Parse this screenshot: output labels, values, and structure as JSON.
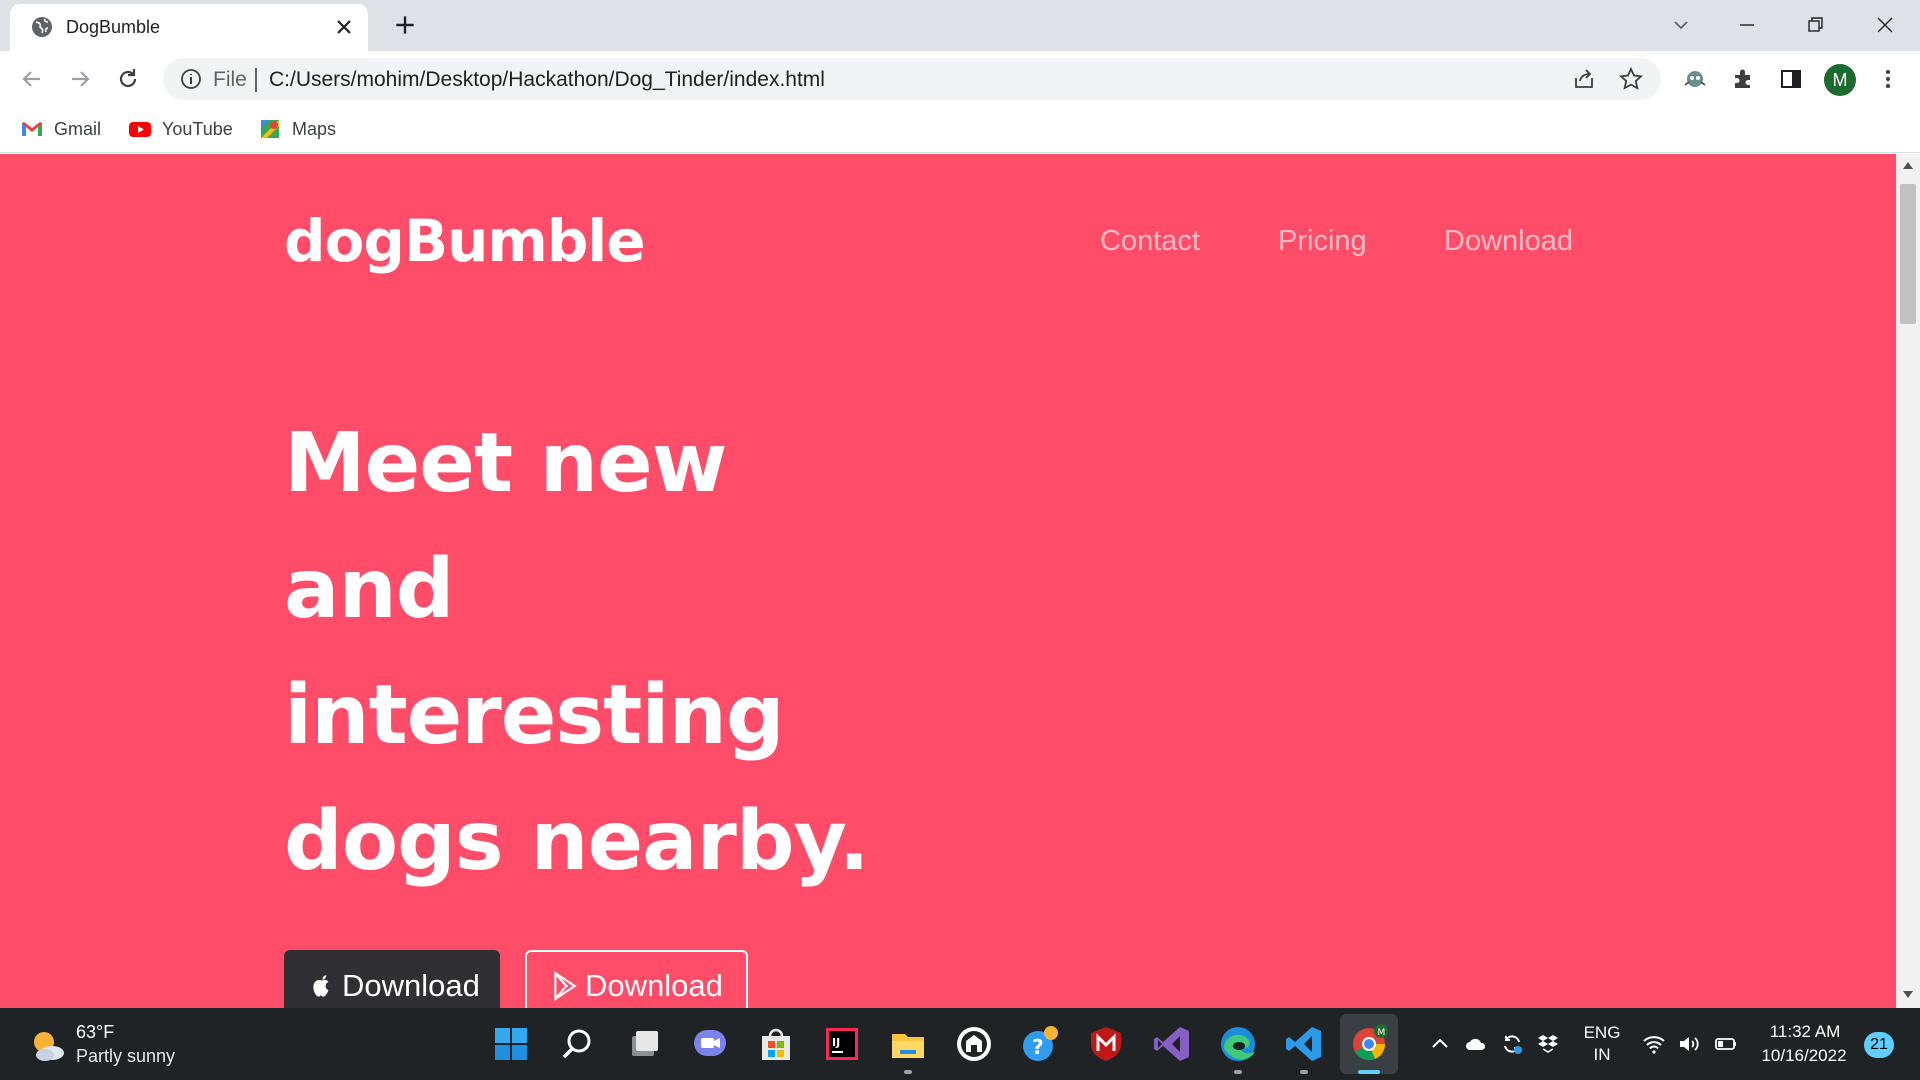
{
  "browser": {
    "tab_title": "DogBumble",
    "url_scheme": "File",
    "url": "C:/Users/mohim/Desktop/Hackathon/Dog_Tinder/index.html",
    "profile_initial": "M",
    "bookmarks": [
      {
        "label": "Gmail",
        "icon": "gmail-icon"
      },
      {
        "label": "YouTube",
        "icon": "youtube-icon"
      },
      {
        "label": "Maps",
        "icon": "maps-icon"
      }
    ]
  },
  "page": {
    "brand": "dogBumble",
    "nav": [
      "Contact",
      "Pricing",
      "Download"
    ],
    "hero_lines": [
      "Meet new",
      "and",
      "interesting",
      "dogs nearby."
    ],
    "buttons": {
      "apple": "Download",
      "google": "Download"
    },
    "colors": {
      "background": "#ff4c68",
      "dark_button": "#303034"
    }
  },
  "taskbar": {
    "weather_temp": "63°F",
    "weather_desc": "Partly sunny",
    "lang_line1": "ENG",
    "lang_line2": "IN",
    "time": "11:32 AM",
    "date": "10/16/2022",
    "notifications": "21"
  }
}
